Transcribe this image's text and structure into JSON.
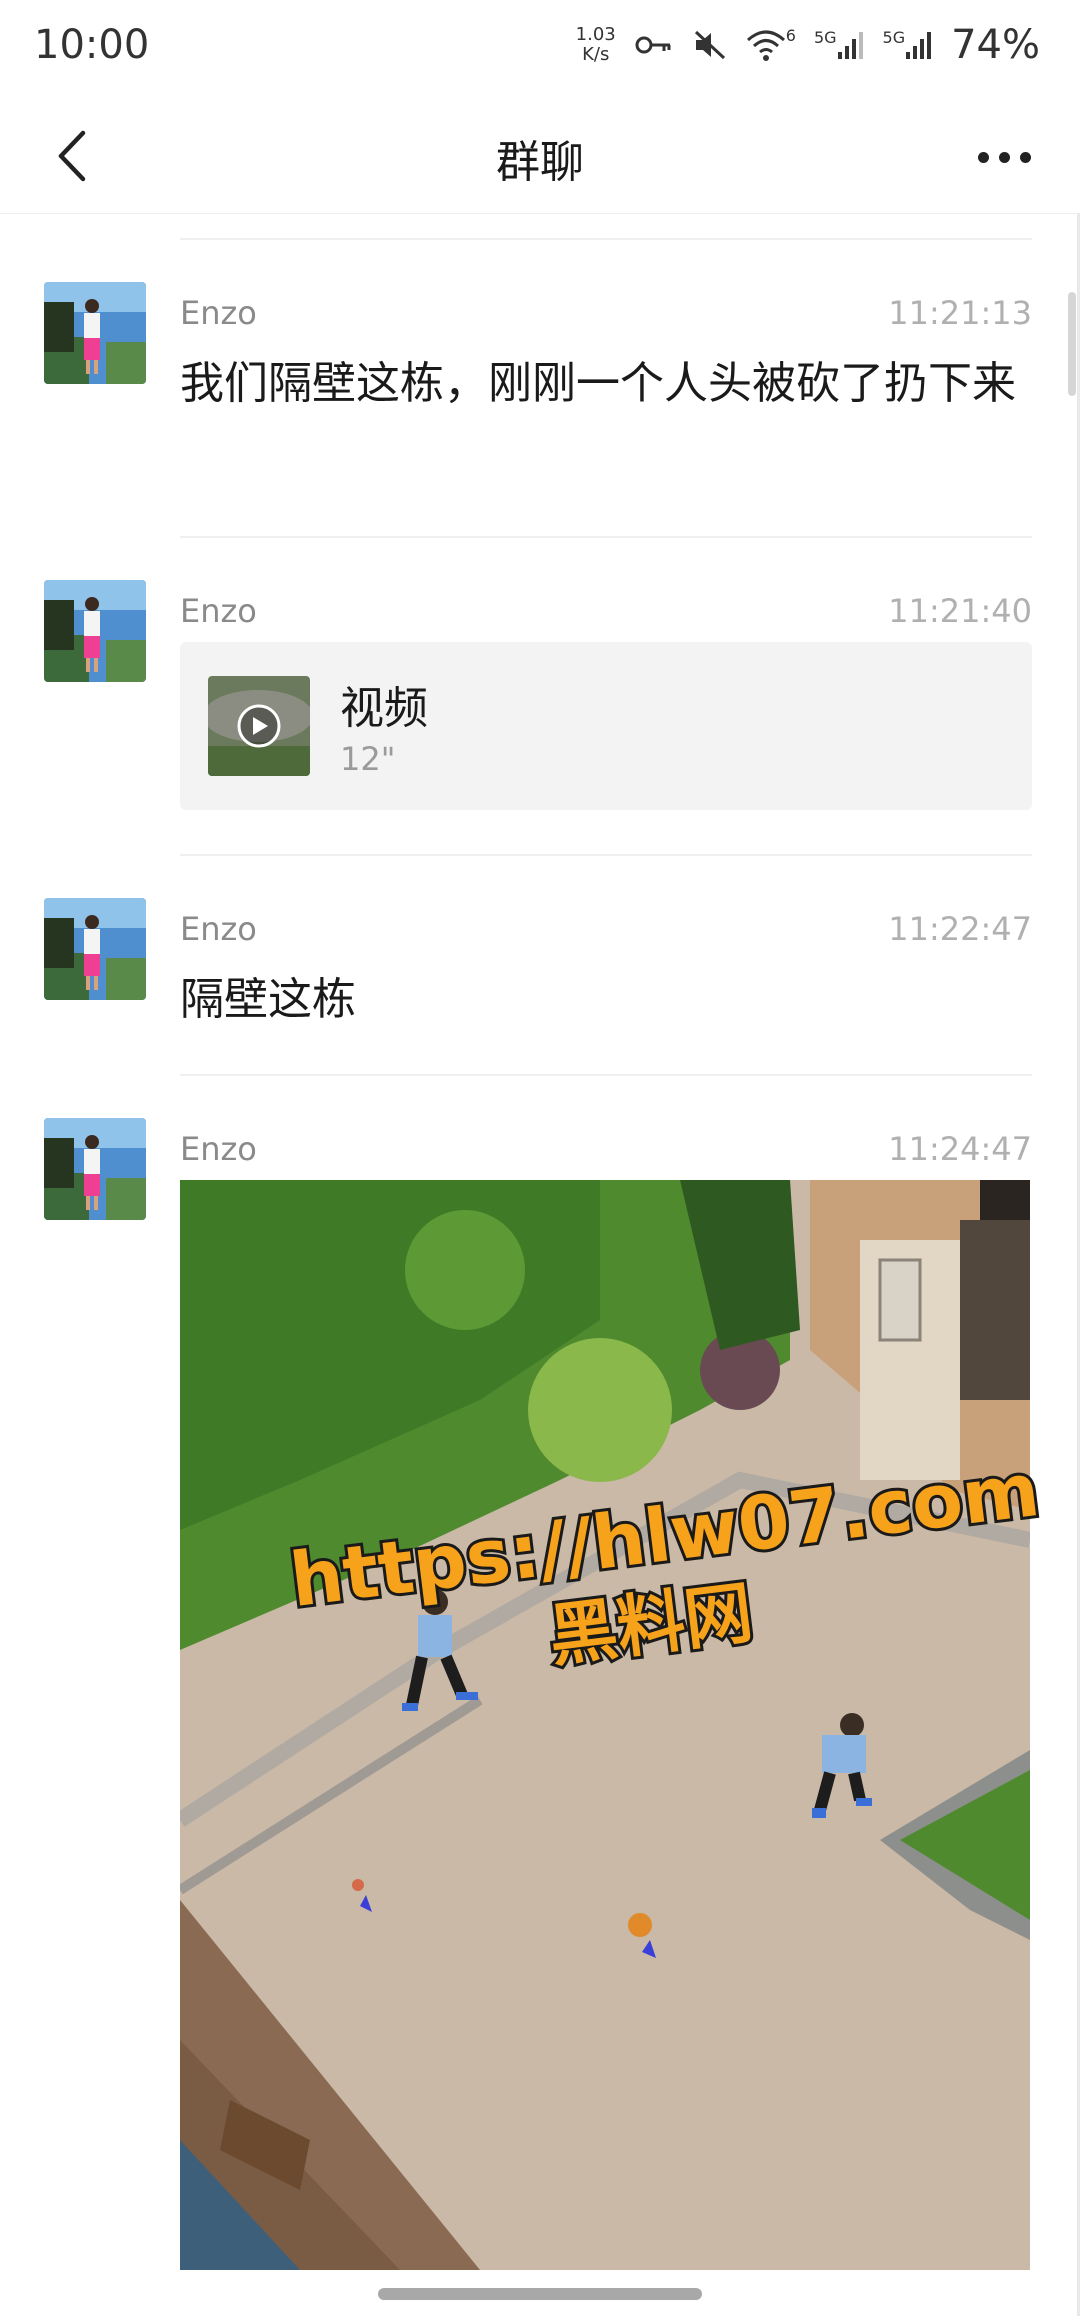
{
  "status_bar": {
    "time": "10:00",
    "net_speed_value": "1.03",
    "net_speed_unit": "K/s",
    "sim1_label": "5G",
    "sim2_label": "5G",
    "wifi_label": "6",
    "battery": "74%",
    "icons": [
      "key-icon",
      "mute-icon",
      "wifi-icon",
      "signal-icon",
      "signal-icon"
    ]
  },
  "header": {
    "title": "群聊",
    "back_icon": "chevron-left-icon",
    "more_icon": "more-horizontal-icon"
  },
  "messages": [
    {
      "sender": "Enzo",
      "time": "11:21:13",
      "type": "text",
      "text": "我们隔壁这栋，刚刚一个人头被砍了扔下来"
    },
    {
      "sender": "Enzo",
      "time": "11:21:40",
      "type": "video",
      "video_title": "视频",
      "video_duration": "12\""
    },
    {
      "sender": "Enzo",
      "time": "11:22:47",
      "type": "text",
      "text": "隔壁这栋"
    },
    {
      "sender": "Enzo",
      "time": "11:24:47",
      "type": "image"
    }
  ],
  "watermark": {
    "url": "https://hlw07.com",
    "name": "黑料网"
  },
  "colors": {
    "background": "#ffffff",
    "sender_gray": "#8a8a8a",
    "time_gray": "#b0b0b0",
    "video_card_bg": "#f3f3f3",
    "watermark_fill": "#f7a21b"
  }
}
